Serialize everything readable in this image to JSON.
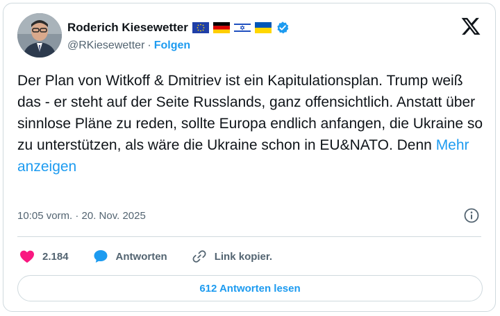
{
  "author": {
    "name": "Roderich Kiesewetter",
    "handle": "@RKiesewetter",
    "separator": "·",
    "follow_label": "Folgen",
    "flags": [
      "eu-flag-icon",
      "germany-flag-icon",
      "israel-flag-icon",
      "ukraine-flag-icon"
    ],
    "verified": true
  },
  "tweet": {
    "text": "Der Plan von Witkoff & Dmitriev ist ein Kapitulationsplan. Trump weiß das - er steht auf der Seite Russlands, ganz offensichtlich. Anstatt über sinnlose Pläne zu reden, sollte Europa endlich anfangen, die Ukraine so zu unterstützen, als wäre die Ukraine schon in EU&NATO. Denn ",
    "more_label": "Mehr anzeigen",
    "timestamp": "10:05 vorm. · 20. Nov. 2025"
  },
  "actions": {
    "likes": "2.184",
    "reply_label": "Antworten",
    "copy_link_label": "Link kopier."
  },
  "read_replies_label": "612 Antworten lesen",
  "colors": {
    "accent": "#1d9bf0",
    "like": "#f91880",
    "text": "#0f1419",
    "muted": "#536471",
    "border": "#cfd9de"
  }
}
